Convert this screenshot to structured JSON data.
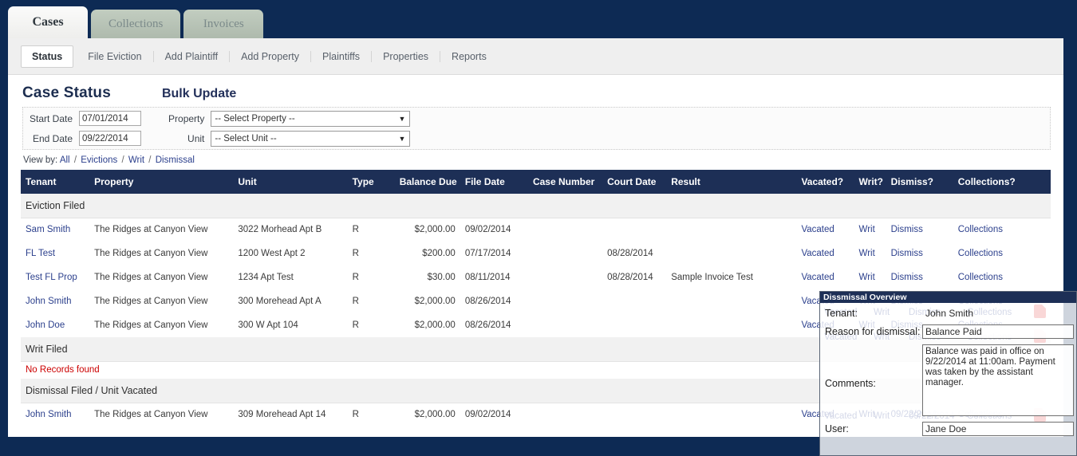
{
  "app": {
    "tabs": [
      {
        "label": "Cases",
        "active": true
      },
      {
        "label": "Collections",
        "active": false
      },
      {
        "label": "Invoices",
        "active": false
      }
    ],
    "subnav": [
      {
        "label": "Status",
        "active": true
      },
      {
        "label": "File Eviction",
        "active": false
      },
      {
        "label": "Add Plaintiff",
        "active": false
      },
      {
        "label": "Add Property",
        "active": false
      },
      {
        "label": "Plaintiffs",
        "active": false
      },
      {
        "label": "Properties",
        "active": false
      },
      {
        "label": "Reports",
        "active": false
      }
    ]
  },
  "header": {
    "page_title": "Case Status",
    "bulk_update": "Bulk Update"
  },
  "filters": {
    "start_date_label": "Start Date",
    "start_date_value": "07/01/2014",
    "end_date_label": "End Date",
    "end_date_value": "09/22/2014",
    "property_label": "Property",
    "property_value": "-- Select Property --",
    "unit_label": "Unit",
    "unit_value": "-- Select Unit --",
    "caret": "▼"
  },
  "viewby": {
    "prefix": "View by:",
    "links": [
      "All",
      "Evictions",
      "Writ",
      "Dismissal"
    ],
    "separator": "/"
  },
  "table": {
    "columns": [
      "Tenant",
      "Property",
      "Unit",
      "Type",
      "Balance Due",
      "File Date",
      "Case Number",
      "Court Date",
      "Result",
      "Vacated?",
      "Writ?",
      "Dismiss?",
      "Collections?"
    ],
    "sections": [
      {
        "title": "Eviction Filed",
        "no_records": null,
        "rows": [
          {
            "tenant": "Sam Smith",
            "property": "The Ridges at Canyon View",
            "unit": "3022 Morhead Apt B",
            "type": "R",
            "balance": "$2,000.00",
            "file_date": "09/02/2014",
            "case_number": "",
            "court_date": "",
            "result": "",
            "vacated": "Vacated",
            "writ": "Writ",
            "dismiss": "Dismiss",
            "collections": "Collections"
          },
          {
            "tenant": "FL Test",
            "property": "The Ridges at Canyon View",
            "unit": "1200 West Apt 2",
            "type": "R",
            "balance": "$200.00",
            "file_date": "07/17/2014",
            "case_number": "",
            "court_date": "08/28/2014",
            "result": "",
            "vacated": "Vacated",
            "writ": "Writ",
            "dismiss": "Dismiss",
            "collections": "Collections"
          },
          {
            "tenant": "Test FL Prop",
            "property": "The Ridges at Canyon View",
            "unit": "1234 Apt Test",
            "type": "R",
            "balance": "$30.00",
            "file_date": "08/11/2014",
            "case_number": "",
            "court_date": "08/28/2014",
            "result": "Sample Invoice Test",
            "vacated": "Vacated",
            "writ": "Writ",
            "dismiss": "Dismiss",
            "collections": "Collections"
          },
          {
            "tenant": "John Smith",
            "property": "The Ridges at Canyon View",
            "unit": "300 Morehead Apt A",
            "type": "R",
            "balance": "$2,000.00",
            "file_date": "08/26/2014",
            "case_number": "",
            "court_date": "",
            "result": "",
            "vacated": "Vacated",
            "writ": "Writ",
            "dismiss": "Dismiss",
            "collections": "Collections"
          },
          {
            "tenant": "John Doe",
            "property": "The Ridges at Canyon View",
            "unit": "300 W Apt 104",
            "type": "R",
            "balance": "$2,000.00",
            "file_date": "08/26/2014",
            "case_number": "",
            "court_date": "",
            "result": "",
            "vacated": "Vacated",
            "writ": "Writ",
            "dismiss": "Dismiss",
            "collections": "Collections"
          }
        ]
      },
      {
        "title": "Writ Filed",
        "no_records": "No Records found",
        "rows": []
      },
      {
        "title": "Dismissal Filed / Unit Vacated",
        "no_records": null,
        "rows": [
          {
            "tenant": "John Smith",
            "property": "The Ridges at Canyon View",
            "unit": "309 Morehead Apt 14",
            "type": "R",
            "balance": "$2,000.00",
            "file_date": "09/02/2014",
            "case_number": "",
            "court_date": "",
            "result": "",
            "vacated": "Vacated",
            "writ": "Writ",
            "dismiss": "09/22/2014",
            "collections": "Collections"
          }
        ]
      }
    ]
  },
  "dialog": {
    "title": "Dissmissal Overview",
    "tenant_label": "Tenant:",
    "tenant_value": "John Smith",
    "reason_label": "Reason for dismissal:",
    "reason_value": "Balance Paid",
    "comments_label": "Comments:",
    "comments_value": "Balance was paid in office on 9/22/2014 at 11:00am. Payment was taken by the assistant manager.",
    "user_label": "User:",
    "user_value": "Jane Doe"
  },
  "colors": {
    "chrome_navy": "#0d2a54",
    "table_header": "#1d2f56",
    "link_blue": "#2b3f8c",
    "error_red": "#cc0000",
    "tab_inactive": "#b9c5b8",
    "pdf_icon_red": "#e03a3a"
  }
}
